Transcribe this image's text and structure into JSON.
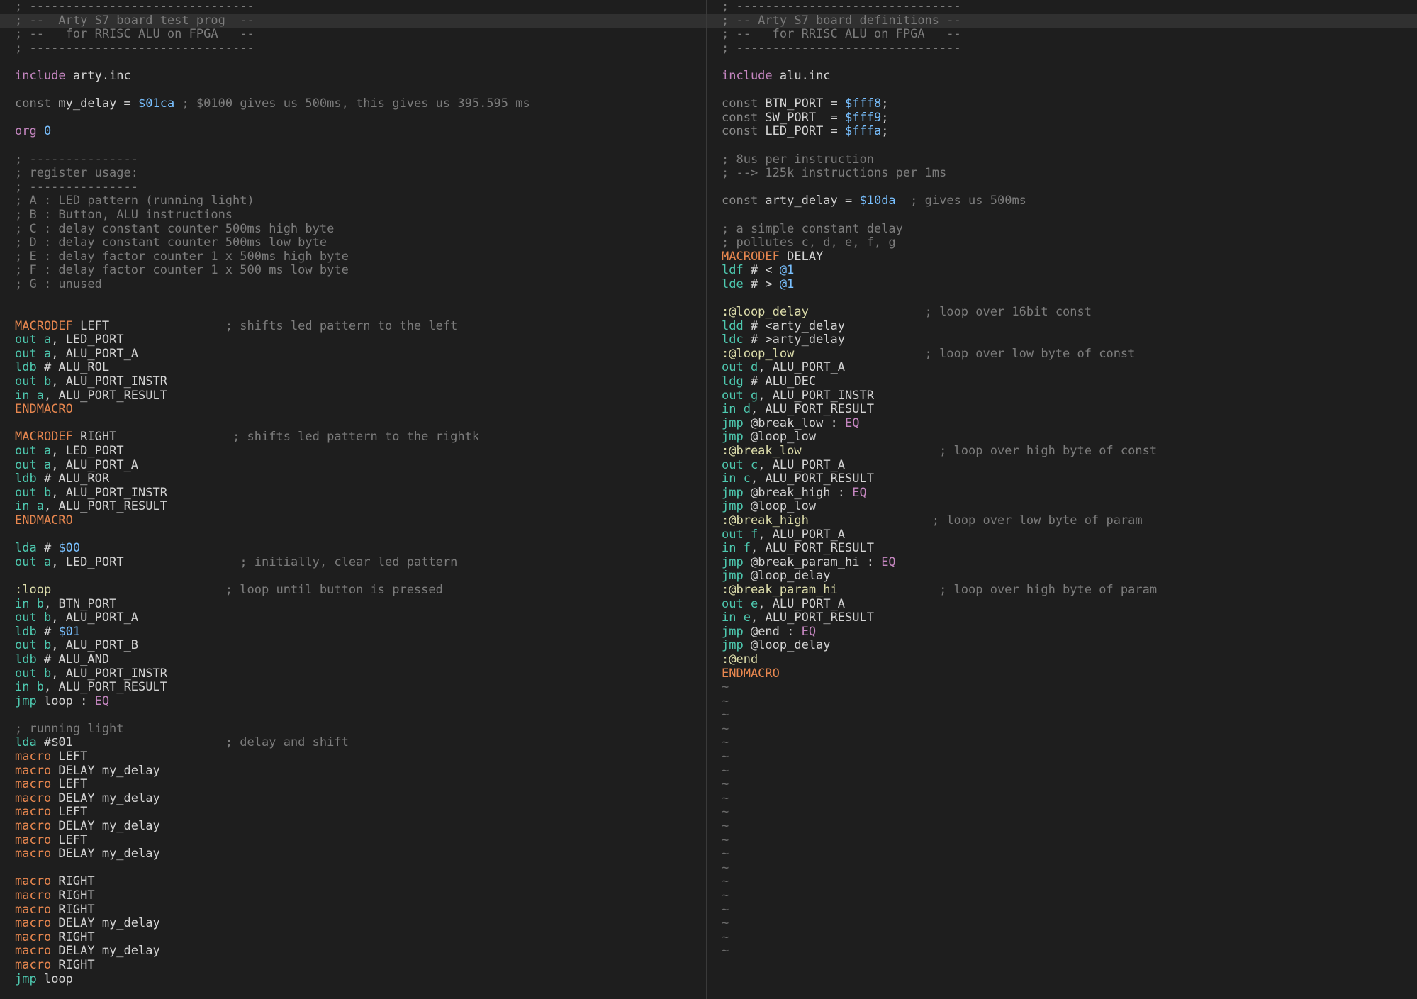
{
  "editor": {
    "theme": "dark",
    "split": "vertical"
  },
  "colors": {
    "background": "#1e1e1e",
    "cursorline": "#303030",
    "comment": "#7c7c7c",
    "preproc": "#c586c0",
    "instruction": "#4ec9b0",
    "number": "#79c0ff",
    "macro_keyword": "#e8874f",
    "label": "#dcdcaa",
    "condition": "#c586c0",
    "text": "#d4d4d4",
    "tilde": "#6a6a6a"
  },
  "left_pane": {
    "cursorline_index": 1,
    "lines": [
      [
        [
          "cm",
          "; -------------------------------"
        ]
      ],
      [
        [
          "cm",
          "; --  Arty S7 board test prog  --"
        ]
      ],
      [
        [
          "cm",
          "; --   for RRISC ALU on FPGA   --"
        ]
      ],
      [
        [
          "cm",
          "; -------------------------------"
        ]
      ],
      [],
      [
        [
          "pp",
          "include"
        ],
        [
          "tx",
          " arty.inc"
        ]
      ],
      [],
      [
        [
          "dc",
          "const"
        ],
        [
          "tx",
          " my_delay = "
        ],
        [
          "nm",
          "$01ca"
        ],
        [
          "cm",
          " ; $0100 gives us 500ms, this gives us 395.595 ms"
        ]
      ],
      [],
      [
        [
          "pp",
          "org"
        ],
        [
          "tx",
          " "
        ],
        [
          "nm",
          "0"
        ]
      ],
      [],
      [
        [
          "cm",
          "; ---------------"
        ]
      ],
      [
        [
          "cm",
          "; register usage:"
        ]
      ],
      [
        [
          "cm",
          "; ---------------"
        ]
      ],
      [
        [
          "cm",
          "; A : LED pattern (running light)"
        ]
      ],
      [
        [
          "cm",
          "; B : Button, ALU instructions"
        ]
      ],
      [
        [
          "cm",
          "; C : delay constant counter 500ms high byte"
        ]
      ],
      [
        [
          "cm",
          "; D : delay constant counter 500ms low byte"
        ]
      ],
      [
        [
          "cm",
          "; E : delay factor counter 1 x 500ms high byte"
        ]
      ],
      [
        [
          "cm",
          "; F : delay factor counter 1 x 500 ms low byte"
        ]
      ],
      [
        [
          "cm",
          "; G : unused"
        ]
      ],
      [],
      [],
      [
        [
          "kw",
          "MACRODEF"
        ],
        [
          "tx",
          " LEFT                "
        ],
        [
          "cm",
          "; shifts led pattern to the left"
        ]
      ],
      [
        [
          "op",
          "out"
        ],
        [
          "tx",
          " "
        ],
        [
          "rg",
          "a"
        ],
        [
          "tx",
          ", LED_PORT"
        ]
      ],
      [
        [
          "op",
          "out"
        ],
        [
          "tx",
          " "
        ],
        [
          "rg",
          "a"
        ],
        [
          "tx",
          ", ALU_PORT_A"
        ]
      ],
      [
        [
          "op",
          "ldb"
        ],
        [
          "tx",
          " # ALU_ROL"
        ]
      ],
      [
        [
          "op",
          "out"
        ],
        [
          "tx",
          " "
        ],
        [
          "rg",
          "b"
        ],
        [
          "tx",
          ", ALU_PORT_INSTR"
        ]
      ],
      [
        [
          "op",
          "in"
        ],
        [
          "tx",
          " "
        ],
        [
          "rg",
          "a"
        ],
        [
          "tx",
          ", ALU_PORT_RESULT"
        ]
      ],
      [
        [
          "kw",
          "ENDMACRO"
        ]
      ],
      [],
      [
        [
          "kw",
          "MACRODEF"
        ],
        [
          "tx",
          " RIGHT                "
        ],
        [
          "cm",
          "; shifts led pattern to the rightk"
        ]
      ],
      [
        [
          "op",
          "out"
        ],
        [
          "tx",
          " "
        ],
        [
          "rg",
          "a"
        ],
        [
          "tx",
          ", LED_PORT"
        ]
      ],
      [
        [
          "op",
          "out"
        ],
        [
          "tx",
          " "
        ],
        [
          "rg",
          "a"
        ],
        [
          "tx",
          ", ALU_PORT_A"
        ]
      ],
      [
        [
          "op",
          "ldb"
        ],
        [
          "tx",
          " # ALU_ROR"
        ]
      ],
      [
        [
          "op",
          "out"
        ],
        [
          "tx",
          " "
        ],
        [
          "rg",
          "b"
        ],
        [
          "tx",
          ", ALU_PORT_INSTR"
        ]
      ],
      [
        [
          "op",
          "in"
        ],
        [
          "tx",
          " "
        ],
        [
          "rg",
          "a"
        ],
        [
          "tx",
          ", ALU_PORT_RESULT"
        ]
      ],
      [
        [
          "kw",
          "ENDMACRO"
        ]
      ],
      [],
      [
        [
          "op",
          "lda"
        ],
        [
          "tx",
          " # "
        ],
        [
          "nm",
          "$00"
        ]
      ],
      [
        [
          "op",
          "out"
        ],
        [
          "tx",
          " "
        ],
        [
          "rg",
          "a"
        ],
        [
          "tx",
          ", LED_PORT                "
        ],
        [
          "cm",
          "; initially, clear led pattern"
        ]
      ],
      [],
      [
        [
          "lb",
          ":loop"
        ],
        [
          "tx",
          "                        "
        ],
        [
          "cm",
          "; loop until button is pressed"
        ]
      ],
      [
        [
          "op",
          "in"
        ],
        [
          "tx",
          " "
        ],
        [
          "rg",
          "b"
        ],
        [
          "tx",
          ", BTN_PORT"
        ]
      ],
      [
        [
          "op",
          "out"
        ],
        [
          "tx",
          " "
        ],
        [
          "rg",
          "b"
        ],
        [
          "tx",
          ", ALU_PORT_A"
        ]
      ],
      [
        [
          "op",
          "ldb"
        ],
        [
          "tx",
          " # "
        ],
        [
          "nm",
          "$01"
        ]
      ],
      [
        [
          "op",
          "out"
        ],
        [
          "tx",
          " "
        ],
        [
          "rg",
          "b"
        ],
        [
          "tx",
          ", ALU_PORT_B"
        ]
      ],
      [
        [
          "op",
          "ldb"
        ],
        [
          "tx",
          " # ALU_AND"
        ]
      ],
      [
        [
          "op",
          "out"
        ],
        [
          "tx",
          " "
        ],
        [
          "rg",
          "b"
        ],
        [
          "tx",
          ", ALU_PORT_INSTR"
        ]
      ],
      [
        [
          "op",
          "in"
        ],
        [
          "tx",
          " "
        ],
        [
          "rg",
          "b"
        ],
        [
          "tx",
          ", ALU_PORT_RESULT"
        ]
      ],
      [
        [
          "op",
          "jmp"
        ],
        [
          "tx",
          " loop : "
        ],
        [
          "cc",
          "EQ"
        ]
      ],
      [],
      [
        [
          "cm",
          "; running light"
        ]
      ],
      [
        [
          "op",
          "lda"
        ],
        [
          "tx",
          " #$01                     "
        ],
        [
          "cm",
          "; delay and shift"
        ]
      ],
      [
        [
          "kw",
          "macro"
        ],
        [
          "tx",
          " LEFT"
        ]
      ],
      [
        [
          "kw",
          "macro"
        ],
        [
          "tx",
          " DELAY my_delay"
        ]
      ],
      [
        [
          "kw",
          "macro"
        ],
        [
          "tx",
          " LEFT"
        ]
      ],
      [
        [
          "kw",
          "macro"
        ],
        [
          "tx",
          " DELAY my_delay"
        ]
      ],
      [
        [
          "kw",
          "macro"
        ],
        [
          "tx",
          " LEFT"
        ]
      ],
      [
        [
          "kw",
          "macro"
        ],
        [
          "tx",
          " DELAY my_delay"
        ]
      ],
      [
        [
          "kw",
          "macro"
        ],
        [
          "tx",
          " LEFT"
        ]
      ],
      [
        [
          "kw",
          "macro"
        ],
        [
          "tx",
          " DELAY my_delay"
        ]
      ],
      [],
      [
        [
          "kw",
          "macro"
        ],
        [
          "tx",
          " RIGHT"
        ]
      ],
      [
        [
          "kw",
          "macro"
        ],
        [
          "tx",
          " RIGHT"
        ]
      ],
      [
        [
          "kw",
          "macro"
        ],
        [
          "tx",
          " RIGHT"
        ]
      ],
      [
        [
          "kw",
          "macro"
        ],
        [
          "tx",
          " DELAY my_delay"
        ]
      ],
      [
        [
          "kw",
          "macro"
        ],
        [
          "tx",
          " RIGHT"
        ]
      ],
      [
        [
          "kw",
          "macro"
        ],
        [
          "tx",
          " DELAY my_delay"
        ]
      ],
      [
        [
          "kw",
          "macro"
        ],
        [
          "tx",
          " RIGHT"
        ]
      ],
      [
        [
          "op",
          "jmp"
        ],
        [
          "tx",
          " loop"
        ]
      ]
    ]
  },
  "right_pane": {
    "cursorline_index": 1,
    "lines": [
      [
        [
          "cm",
          "; -------------------------------"
        ]
      ],
      [
        [
          "cm",
          "; -- Arty S7 board definitions --"
        ]
      ],
      [
        [
          "cm",
          "; --   for RRISC ALU on FPGA   --"
        ]
      ],
      [
        [
          "cm",
          "; -------------------------------"
        ]
      ],
      [],
      [
        [
          "pp",
          "include"
        ],
        [
          "tx",
          " alu.inc"
        ]
      ],
      [],
      [
        [
          "dc",
          "const"
        ],
        [
          "tx",
          " BTN_PORT = "
        ],
        [
          "nm",
          "$fff8"
        ],
        [
          "tx",
          ";"
        ]
      ],
      [
        [
          "dc",
          "const"
        ],
        [
          "tx",
          " SW_PORT  = "
        ],
        [
          "nm",
          "$fff9"
        ],
        [
          "tx",
          ";"
        ]
      ],
      [
        [
          "dc",
          "const"
        ],
        [
          "tx",
          " LED_PORT = "
        ],
        [
          "nm",
          "$fffa"
        ],
        [
          "tx",
          ";"
        ]
      ],
      [],
      [
        [
          "cm",
          "; 8us per instruction"
        ]
      ],
      [
        [
          "cm",
          "; --> 125k instructions per 1ms"
        ]
      ],
      [],
      [
        [
          "dc",
          "const"
        ],
        [
          "tx",
          " arty_delay = "
        ],
        [
          "nm",
          "$10da"
        ],
        [
          "tx",
          "  "
        ],
        [
          "cm",
          "; gives us 500ms"
        ]
      ],
      [],
      [
        [
          "cm",
          "; a simple constant delay"
        ]
      ],
      [
        [
          "cm",
          "; pollutes c, d, e, f, g"
        ]
      ],
      [
        [
          "kw",
          "MACRODEF"
        ],
        [
          "tx",
          " DELAY"
        ]
      ],
      [
        [
          "op",
          "ldf"
        ],
        [
          "tx",
          " # < "
        ],
        [
          "nm",
          "@1"
        ]
      ],
      [
        [
          "op",
          "lde"
        ],
        [
          "tx",
          " # > "
        ],
        [
          "nm",
          "@1"
        ]
      ],
      [],
      [
        [
          "lb",
          ":@loop_delay"
        ],
        [
          "tx",
          "                "
        ],
        [
          "cm",
          "; loop over 16bit const"
        ]
      ],
      [
        [
          "op",
          "ldd"
        ],
        [
          "tx",
          " # <arty_delay"
        ]
      ],
      [
        [
          "op",
          "ldc"
        ],
        [
          "tx",
          " # >arty_delay"
        ]
      ],
      [
        [
          "lb",
          ":@loop_low"
        ],
        [
          "tx",
          "                  "
        ],
        [
          "cm",
          "; loop over low byte of const"
        ]
      ],
      [
        [
          "op",
          "out"
        ],
        [
          "tx",
          " "
        ],
        [
          "rg",
          "d"
        ],
        [
          "tx",
          ", ALU_PORT_A"
        ]
      ],
      [
        [
          "op",
          "ldg"
        ],
        [
          "tx",
          " # ALU_DEC"
        ]
      ],
      [
        [
          "op",
          "out"
        ],
        [
          "tx",
          " "
        ],
        [
          "rg",
          "g"
        ],
        [
          "tx",
          ", ALU_PORT_INSTR"
        ]
      ],
      [
        [
          "op",
          "in"
        ],
        [
          "tx",
          " "
        ],
        [
          "rg",
          "d"
        ],
        [
          "tx",
          ", ALU_PORT_RESULT"
        ]
      ],
      [
        [
          "op",
          "jmp"
        ],
        [
          "tx",
          " @break_low : "
        ],
        [
          "cc",
          "EQ"
        ]
      ],
      [
        [
          "op",
          "jmp"
        ],
        [
          "tx",
          " @loop_low"
        ]
      ],
      [
        [
          "lb",
          ":@break_low"
        ],
        [
          "tx",
          "                   "
        ],
        [
          "cm",
          "; loop over high byte of const"
        ]
      ],
      [
        [
          "op",
          "out"
        ],
        [
          "tx",
          " "
        ],
        [
          "rg",
          "c"
        ],
        [
          "tx",
          ", ALU_PORT_A"
        ]
      ],
      [
        [
          "op",
          "in"
        ],
        [
          "tx",
          " "
        ],
        [
          "rg",
          "c"
        ],
        [
          "tx",
          ", ALU_PORT_RESULT"
        ]
      ],
      [
        [
          "op",
          "jmp"
        ],
        [
          "tx",
          " @break_high : "
        ],
        [
          "cc",
          "EQ"
        ]
      ],
      [
        [
          "op",
          "jmp"
        ],
        [
          "tx",
          " @loop_low"
        ]
      ],
      [
        [
          "lb",
          ":@break_high"
        ],
        [
          "tx",
          "                 "
        ],
        [
          "cm",
          "; loop over low byte of param"
        ]
      ],
      [
        [
          "op",
          "out"
        ],
        [
          "tx",
          " "
        ],
        [
          "rg",
          "f"
        ],
        [
          "tx",
          ", ALU_PORT_A"
        ]
      ],
      [
        [
          "op",
          "in"
        ],
        [
          "tx",
          " "
        ],
        [
          "rg",
          "f"
        ],
        [
          "tx",
          ", ALU_PORT_RESULT"
        ]
      ],
      [
        [
          "op",
          "jmp"
        ],
        [
          "tx",
          " @break_param_hi : "
        ],
        [
          "cc",
          "EQ"
        ]
      ],
      [
        [
          "op",
          "jmp"
        ],
        [
          "tx",
          " @loop_delay"
        ]
      ],
      [
        [
          "lb",
          ":@break_param_hi"
        ],
        [
          "tx",
          "              "
        ],
        [
          "cm",
          "; loop over high byte of param"
        ]
      ],
      [
        [
          "op",
          "out"
        ],
        [
          "tx",
          " "
        ],
        [
          "rg",
          "e"
        ],
        [
          "tx",
          ", ALU_PORT_A"
        ]
      ],
      [
        [
          "op",
          "in"
        ],
        [
          "tx",
          " "
        ],
        [
          "rg",
          "e"
        ],
        [
          "tx",
          ", ALU_PORT_RESULT"
        ]
      ],
      [
        [
          "op",
          "jmp"
        ],
        [
          "tx",
          " @end : "
        ],
        [
          "cc",
          "EQ"
        ]
      ],
      [
        [
          "op",
          "jmp"
        ],
        [
          "tx",
          " @loop_delay"
        ]
      ],
      [
        [
          "lb",
          ":@end"
        ]
      ],
      [
        [
          "kw",
          "ENDMACRO"
        ]
      ]
    ],
    "empty_line_marker": "~",
    "empty_line_count": 20
  }
}
